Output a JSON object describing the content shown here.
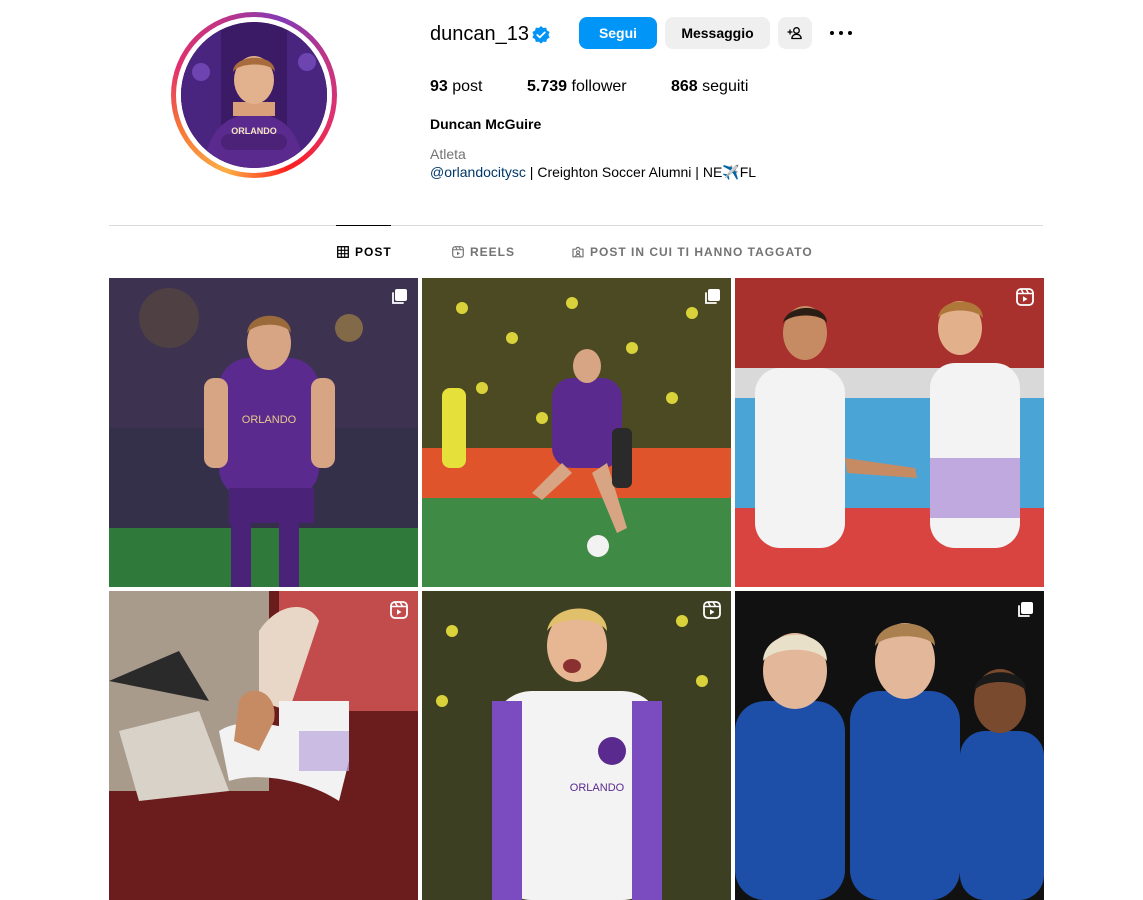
{
  "profile": {
    "username": "duncan_13",
    "verified_icon": "verified-badge-icon",
    "full_name": "Duncan McGuire",
    "category": "Atleta",
    "bio_mention": "@orlandocitysc",
    "bio_text": " | Creighton Soccer Alumni | NE✈️FL"
  },
  "actions": {
    "follow_label": "Segui",
    "message_label": "Messaggio",
    "add_user_icon": "add-user-icon",
    "more_icon": "more-options-icon"
  },
  "stats": {
    "posts_count": "93",
    "posts_label": "post",
    "followers_count": "5.739",
    "followers_label": "follower",
    "following_count": "868",
    "following_label": "seguiti"
  },
  "tabs": [
    {
      "label": "POST",
      "icon": "grid-icon",
      "active": true
    },
    {
      "label": "REELS",
      "icon": "reels-icon",
      "active": false
    },
    {
      "label": "POST IN CUI TI HANNO TAGGATO",
      "icon": "tagged-icon",
      "active": false
    }
  ],
  "posts": [
    {
      "type": "carousel",
      "badge_icon": "carousel-icon"
    },
    {
      "type": "carousel",
      "badge_icon": "carousel-icon"
    },
    {
      "type": "reel",
      "badge_icon": "reel-icon"
    },
    {
      "type": "reel",
      "badge_icon": "reel-icon"
    },
    {
      "type": "reel",
      "badge_icon": "reel-icon"
    },
    {
      "type": "carousel",
      "badge_icon": "carousel-icon"
    }
  ],
  "colors": {
    "accent_blue": "#0095f6",
    "button_grey": "#efefef",
    "link_blue": "#00376b",
    "muted_text": "#737373",
    "divider": "#dbdbdb",
    "team_purple": "#5b2a8f"
  }
}
